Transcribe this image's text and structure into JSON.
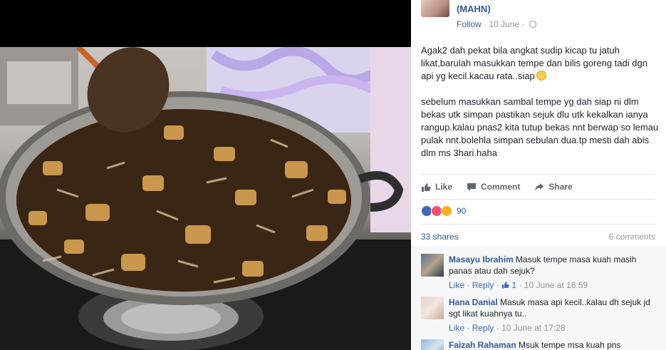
{
  "post": {
    "author_name": "(MAHN)",
    "follow_label": "Follow",
    "date": "10 June",
    "paragraph_1": "Agak2 dah pekat bila angkat sudip kicap tu jatuh likat,barulah masukkan tempe dan bilis goreng tadi dgn api yg kecil.kacau rata..siap",
    "paragraph_2": "sebelum masukkan sambal tempe yg dah siap ni dlm bekas utk simpan pastikan sejuk dlu utk kekalkan ianya rangup.kalau pnas2 kita tutup bekas nnt berwap so lemau pulak nnt.bolehla simpan sebulan dua.tp mesti dah abis dlm ms 3hari.haha"
  },
  "actions": {
    "like": "Like",
    "comment": "Comment",
    "share": "Share"
  },
  "stats": {
    "reaction_count": "90",
    "shares": "33 shares",
    "comments": "6 comments"
  },
  "comments": [
    {
      "name": "Masayu Ibrahim",
      "text": "Masuk tempe masa kuah masih panas atau dah sejuk?",
      "like": "Like",
      "reply": "Reply",
      "likes": "1",
      "time": "10 June at 16:59"
    },
    {
      "name": "Hana Danial",
      "text": "Masuk masa api kecil..kalau dh sejuk jd sgt likat kuahnya tu..",
      "like": "Like",
      "reply": "Reply",
      "time": "10 June at 17:28"
    },
    {
      "name": "Faizah Rahaman",
      "text": "Msuk tempe msa kuah pns"
    }
  ],
  "icons": {
    "globe": "globe-icon",
    "like": "thumbs-up-icon",
    "comment": "speech-bubble-icon",
    "share": "share-arrow-icon",
    "reactions": [
      "like-reaction-icon",
      "love-reaction-icon",
      "wow-reaction-icon"
    ]
  },
  "colors": {
    "link": "#365899",
    "muted": "#90949c",
    "comments_bg": "#f6f7f9"
  }
}
